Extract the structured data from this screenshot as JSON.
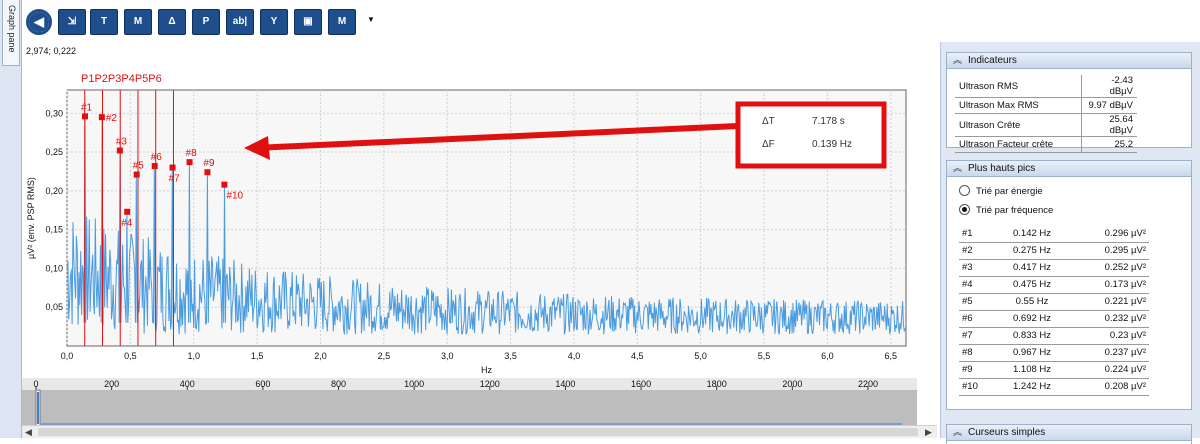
{
  "side_tab": {
    "label": "Graph pane"
  },
  "toolbar": {
    "buttons": [
      {
        "name": "back-button",
        "icon": "back-arrow-icon",
        "text": "◀"
      },
      {
        "name": "export-button",
        "icon": "export-icon",
        "text": "⇲"
      },
      {
        "name": "tool-t-button",
        "icon": "t-marker-icon",
        "text": "T",
        "sub": ""
      },
      {
        "name": "tool-m-button",
        "icon": "m-marker-icon",
        "text": "M",
        "sub": ""
      },
      {
        "name": "tool-delta-button",
        "icon": "delta-marker-icon",
        "text": "Δ",
        "sub": ""
      },
      {
        "name": "tool-p-button",
        "icon": "peak-marker-icon",
        "text": "P",
        "sub": ""
      },
      {
        "name": "tool-label-button",
        "icon": "label-icon",
        "text": "ab|",
        "sub": ""
      },
      {
        "name": "tool-y-button",
        "icon": "y-marker-icon",
        "text": "Y",
        "sub": ""
      },
      {
        "name": "tool-zoom-button",
        "icon": "zoom-box-icon",
        "text": "▣",
        "sub": ""
      },
      {
        "name": "tool-m-clear-button",
        "icon": "m-clear-icon",
        "text": "M",
        "sub": ""
      }
    ]
  },
  "cursor_readout": "2,974; 0,222",
  "chart_data": {
    "type": "line",
    "ylabel": "µV² (env. PSP RMS)",
    "xlabel": "Hz",
    "xlim": [
      0,
      6.62
    ],
    "ylim": [
      0,
      0.33
    ],
    "x_ticks": [
      "0,0",
      "0,5",
      "1,0",
      "1,5",
      "2,0",
      "2,5",
      "3,0",
      "3,5",
      "4,0",
      "4,5",
      "5,0",
      "5,5",
      "6,0",
      "6,5"
    ],
    "y_ticks": [
      "0,05",
      "0,10",
      "0,15",
      "0,20",
      "0,25",
      "0,30"
    ],
    "series": [
      {
        "name": "",
        "color": "#4a9be0"
      }
    ],
    "peaks": [
      {
        "label": "#1",
        "x": 0.142,
        "y": 0.296
      },
      {
        "label": "#2",
        "x": 0.275,
        "y": 0.295
      },
      {
        "label": "#3",
        "x": 0.417,
        "y": 0.252
      },
      {
        "label": "#4",
        "x": 0.475,
        "y": 0.173
      },
      {
        "label": "#5",
        "x": 0.55,
        "y": 0.221
      },
      {
        "label": "#6",
        "x": 0.692,
        "y": 0.232
      },
      {
        "label": "#7",
        "x": 0.833,
        "y": 0.23
      },
      {
        "label": "#8",
        "x": 0.967,
        "y": 0.237
      },
      {
        "label": "#9",
        "x": 1.108,
        "y": 0.224
      },
      {
        "label": "#10",
        "x": 1.242,
        "y": 0.208
      }
    ],
    "markers": [
      {
        "label": "P1",
        "x": 0.14
      },
      {
        "label": "P2",
        "x": 0.28
      },
      {
        "label": "P3",
        "x": 0.42
      },
      {
        "label": "P4",
        "x": 0.56
      },
      {
        "label": "P5",
        "x": 0.7
      },
      {
        "label": "P6",
        "x": 0.84
      }
    ],
    "marker_header": "P1P2P3P4P5P6",
    "annotation": {
      "dt_label": "ΔT",
      "dt_value": "7.178 s",
      "df_label": "ΔF",
      "df_value": "0.139 Hz"
    },
    "nav_ticks": [
      "0",
      "200",
      "400",
      "600",
      "800",
      "1000",
      "1200",
      "1400",
      "1600",
      "1800",
      "2000",
      "2200"
    ],
    "nav_max": 2290
  },
  "indicators": {
    "title": "Indicateurs",
    "rows": [
      {
        "label": "Ultrason RMS",
        "value": "-2.43 dBµV"
      },
      {
        "label": "Ultrason Max RMS",
        "value": "9.97 dBµV"
      },
      {
        "label": "Ultrason Crête",
        "value": "25.64 dBµV"
      },
      {
        "label": "Ultrason Facteur crête",
        "value": "25.2"
      }
    ]
  },
  "peaks_panel": {
    "title": "Plus hauts pics",
    "radio_energy": "Trié par énergie",
    "radio_frequency": "Trié par fréquence",
    "rows": [
      {
        "id": "#1",
        "freq": "0.142 Hz",
        "val": "0.296 µV²"
      },
      {
        "id": "#2",
        "freq": "0.275 Hz",
        "val": "0.295 µV²"
      },
      {
        "id": "#3",
        "freq": "0.417 Hz",
        "val": "0.252 µV²"
      },
      {
        "id": "#4",
        "freq": "0.475 Hz",
        "val": "0.173 µV²"
      },
      {
        "id": "#5",
        "freq": "0.55 Hz",
        "val": "0.221 µV²"
      },
      {
        "id": "#6",
        "freq": "0.692 Hz",
        "val": "0.232 µV²"
      },
      {
        "id": "#7",
        "freq": "0.833 Hz",
        "val": "0.23 µV²"
      },
      {
        "id": "#8",
        "freq": "0.967 Hz",
        "val": "0.237 µV²"
      },
      {
        "id": "#9",
        "freq": "1.108 Hz",
        "val": "0.224 µV²"
      },
      {
        "id": "#10",
        "freq": "1.242 Hz",
        "val": "0.208 µV²"
      }
    ]
  },
  "cursors_panel": {
    "title": "Curseurs simples"
  },
  "colors": {
    "accent": "#1f4e8c",
    "signal": "#4a9be0",
    "marker_red": "#e01010",
    "plot_bg": "#f7f7f7"
  }
}
